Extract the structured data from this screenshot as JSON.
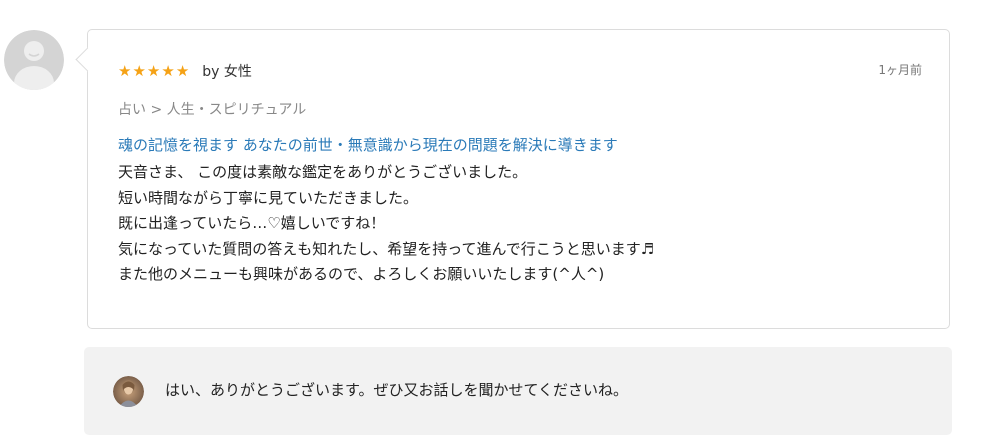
{
  "review": {
    "rating": 5,
    "stars": [
      "★",
      "★",
      "★",
      "★",
      "★"
    ],
    "author": "by 女性",
    "time_ago": "1ヶ月前",
    "category": "占い > 人生・スピリチュアル",
    "service_title": "魂の記憶を視ます あなたの前世・無意識から現在の問題を解決に導きます",
    "body_lines": [
      "天音さま、 この度は素敵な鑑定をありがとうございました。",
      "短い時間ながら丁寧に見ていただきました。",
      "既に出逢っていたら…♡嬉しいですね！",
      "気になっていた質問の答えも知れたし、希望を持って進んで行こうと思います♬",
      "また他のメニューも興味があるので、よろしくお願いいたします(^人^)"
    ]
  },
  "reply": {
    "text": "はい、ありがとうございます。ぜひ又お話しを聞かせてくださいね。"
  },
  "colors": {
    "star": "#f5a216",
    "link": "#2a7ab8",
    "reply_background": "#f2f2f2",
    "card_border": "#dcdcdc"
  },
  "icons": {
    "reviewer_avatar": "default-user-avatar-icon",
    "seller_avatar": "seller-avatar"
  }
}
